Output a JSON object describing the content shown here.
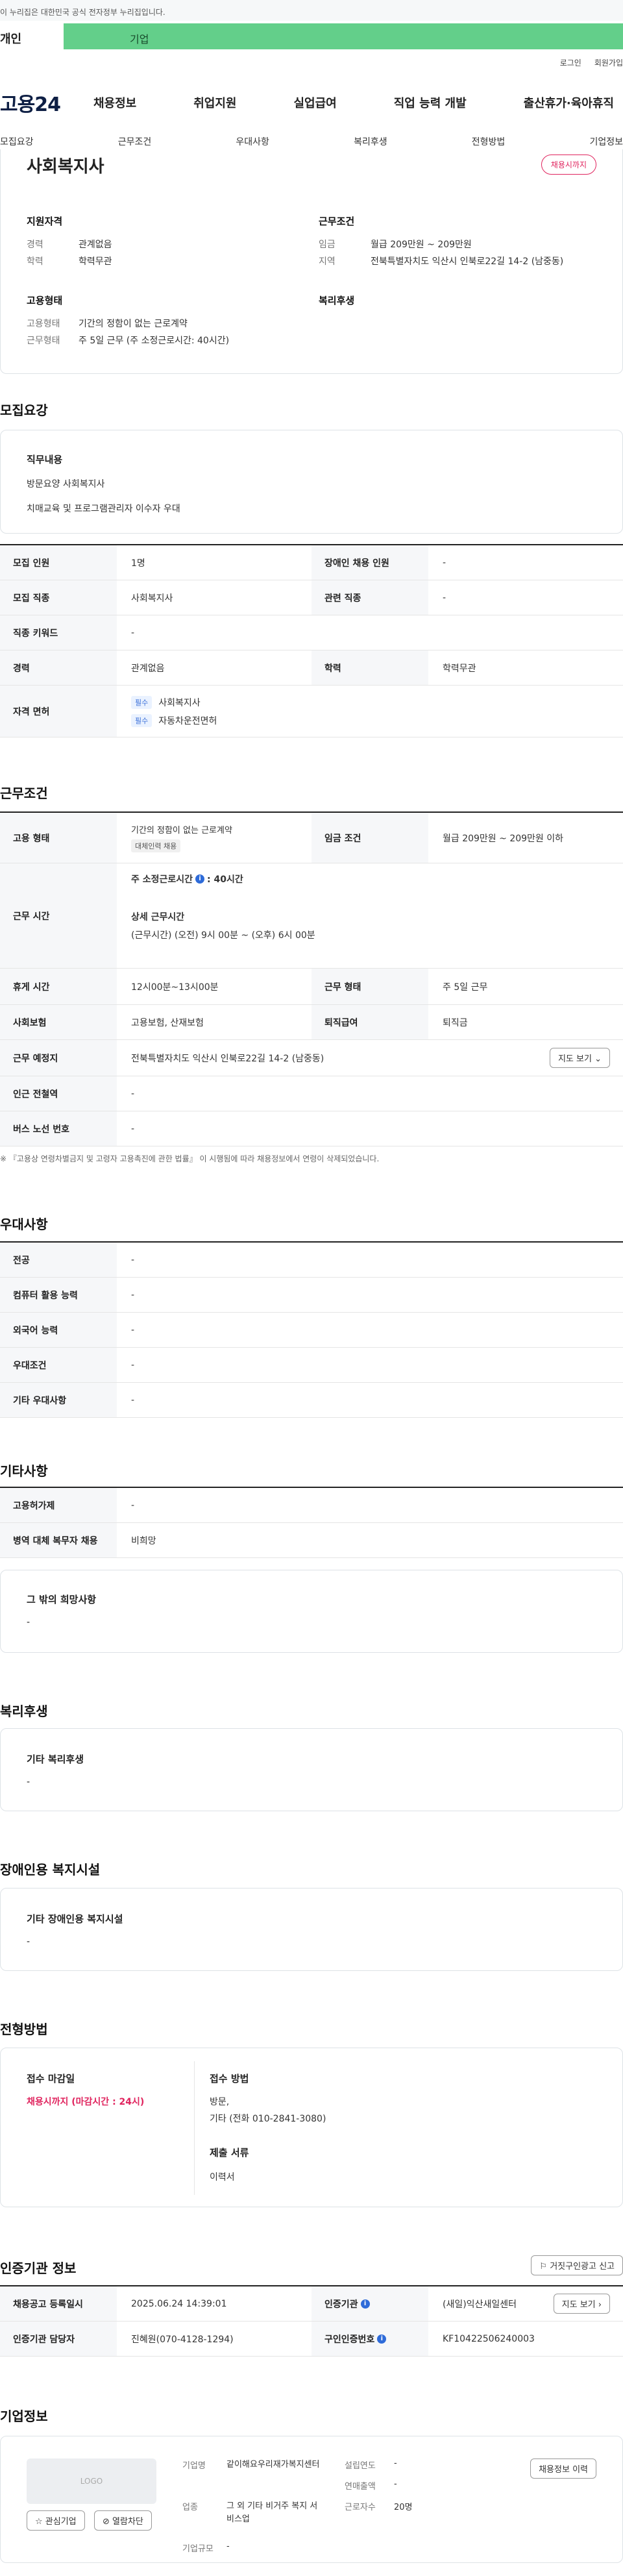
{
  "banner": {
    "text": "이 누리집은 대한민국 공식 전자정부 누리집입니다."
  },
  "toggle": {
    "left": "개인",
    "right": "기업"
  },
  "util": {
    "login": "로그인",
    "signup": "회원가입"
  },
  "gnb": {
    "logo": "고용24",
    "menu": [
      "채용정보",
      "취업지원",
      "실업급여",
      "직업 능력 개발",
      "출산휴가·육아휴직"
    ]
  },
  "tabs": [
    "모집요강",
    "근무조건",
    "우대사항",
    "복리후생",
    "전형방법",
    "기업정보"
  ],
  "job": {
    "title": "사회복지사",
    "badge": "채용시까지",
    "qual_title": "지원자격",
    "qual": [
      {
        "k": "경력",
        "v": "관계없음"
      },
      {
        "k": "학력",
        "v": "학력무관"
      }
    ],
    "cond_title": "근무조건",
    "cond": [
      {
        "k": "임금",
        "v": "월급 209만원 ~ 209만원"
      },
      {
        "k": "지역",
        "v": "전북특별자치도 익산시 인북로22길 14-2 (남중동)"
      }
    ],
    "emp_title": "고용형태",
    "emp": [
      {
        "k": "고용형태",
        "v": "기간의 정함이 없는 근로계약"
      },
      {
        "k": "근무형태",
        "v": "주 5일 근무 (주 소정근로시간: 40시간)"
      }
    ],
    "welfare_title": "복리후생"
  },
  "recruit": {
    "title": "모집요강",
    "duty_title": "직무내용",
    "duty_lines": [
      "방문요양 사회복지사",
      "치매교육 및 프로그램관리자 이수자 우대"
    ],
    "rows": [
      {
        "k1": "모집 인원",
        "v1": "1명",
        "k2": "장애인 채용 인원",
        "v2": "-"
      },
      {
        "k1": "모집 직종",
        "v1": "사회복지사",
        "k2": "관련 직종",
        "v2": "-"
      },
      {
        "k1": "직종 키워드",
        "v1": "-"
      },
      {
        "k1": "경력",
        "v1": "관계없음",
        "k2": "학력",
        "v2": "학력무관"
      }
    ],
    "license_label": "자격 면허",
    "licenses": [
      {
        "tag": "필수",
        "name": "사회복지사"
      },
      {
        "tag": "필수",
        "name": "자동차운전면허"
      }
    ]
  },
  "work": {
    "title": "근무조건",
    "emp_type_label": "고용 형태",
    "emp_type": "기간의 정함이 없는 근로계약",
    "emp_type_tag": "대체인력 채용",
    "wage_label": "임금 조건",
    "wage": "월급 209만원 ~ 209만원 이하",
    "hours_label": "근무 시간",
    "hours_main": "주 소정근로시간",
    "hours_value": ": 40시간",
    "hours_detail_title": "상세 근무시간",
    "hours_detail": "(근무시간) (오전) 9시 00분 ~ (오후) 6시 00분",
    "break_label": "휴게 시간",
    "break": "12시00분~13시00분",
    "shift_label": "근무 형태",
    "shift": "주 5일 근무",
    "insurance_label": "사회보험",
    "insurance": "고용보험, 산재보험",
    "retire_label": "퇴직급여",
    "retire": "퇴직금",
    "place_label": "근무 예정지",
    "place": "전북특별자치도 익산시 인북로22길 14-2 (남중동)",
    "map_btn": "지도 보기",
    "subway_label": "인근 전철역",
    "subway": "-",
    "bus_label": "버스 노선 번호",
    "bus": "-",
    "note": "※ 『고용상 연령차별금지 및 고령자 고용촉진에 관한 법률』 이 시행됨에 따라 채용정보에서 연령이 삭제되었습니다."
  },
  "prefer": {
    "title": "우대사항",
    "rows": [
      {
        "k": "전공",
        "v": "-"
      },
      {
        "k": "컴퓨터 활용 능력",
        "v": "-"
      },
      {
        "k": "외국어 능력",
        "v": "-"
      },
      {
        "k": "우대조건",
        "v": "-"
      },
      {
        "k": "기타 우대사항",
        "v": "-"
      }
    ]
  },
  "etc": {
    "title": "기타사항",
    "rows": [
      {
        "k": "고용허가제",
        "v": "-"
      },
      {
        "k": "병역 대체 복무자 채용",
        "v": "비희망"
      }
    ],
    "box_title": "그 밖의 희망사항",
    "box_value": "-"
  },
  "welfare": {
    "title": "복리후생",
    "box_title": "기타 복리후생",
    "box_value": "-"
  },
  "disabled": {
    "title": "장애인용 복지시설",
    "box_title": "기타 장애인용 복지시설",
    "box_value": "-"
  },
  "screen": {
    "title": "전형방법",
    "deadline_title": "접수 마감일",
    "deadline": "채용시까지 (마감시간 : 24시)",
    "method_title": "접수 방법",
    "method_lines": [
      "방문,",
      "기타 (전화 010-2841-3080)"
    ],
    "docs_title": "제출 서류",
    "docs": "이력서"
  },
  "cert": {
    "title": "인증기관 정보",
    "report_btn": "거짓구인광고 신고",
    "reg_label": "채용공고 등록일시",
    "reg": "2025.06.24 14:39:01",
    "org_label": "인증기관",
    "org": "(새일)익산새일센터",
    "map_btn": "지도 보기",
    "staff_label": "인증기관 담당자",
    "staff": "진혜원(070-4128-1294)",
    "num_label": "구인인증번호",
    "num": "KF10422506240003"
  },
  "company": {
    "title": "기업정보",
    "logo": "LOGO",
    "fav_btn": "관심기업",
    "block_btn": "열람차단",
    "name_label": "기업명",
    "name": "같이해요우리재가복지센터",
    "industry_label": "업종",
    "industry": "그 외 기타 비거주 복지 서비스업",
    "size_label": "기업규모",
    "size": "-",
    "year_label": "설립연도",
    "year": "-",
    "sales_label": "연매출액",
    "sales": "-",
    "staff_label": "근로자수",
    "staff": "20명",
    "history_btn": "채용정보 이력"
  }
}
